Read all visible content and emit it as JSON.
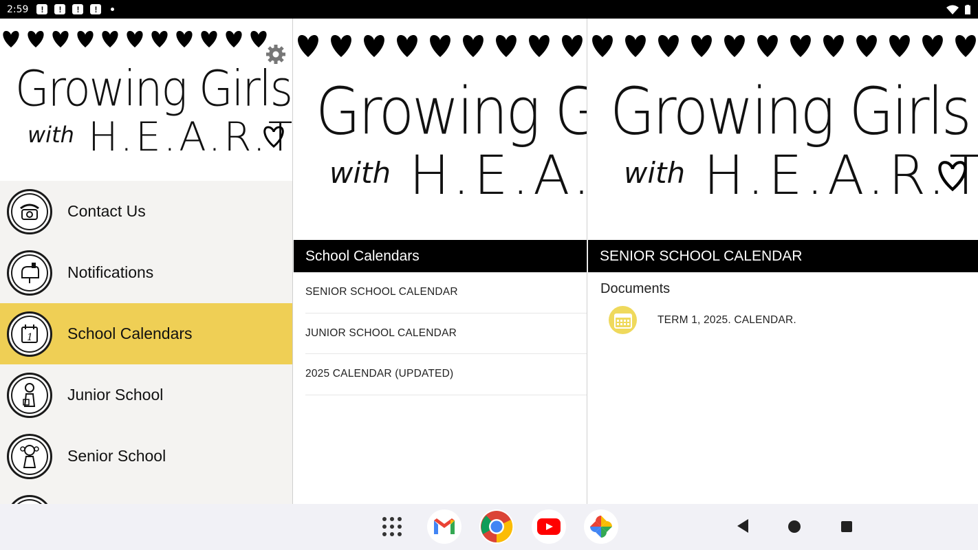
{
  "status_bar": {
    "time": "2:59",
    "notifications": [
      "!",
      "!",
      "!",
      "!"
    ],
    "icons": [
      "wifi-icon",
      "battery-icon"
    ]
  },
  "banner": {
    "title": "Growing Girls",
    "subtitle_with": "with",
    "subtitle_heart": "H.E.A.R.T",
    "accent_color": "#f0e94a"
  },
  "drawer": {
    "settings_icon": "gear-icon",
    "items": [
      {
        "label": "Contact Us",
        "icon": "telephone-icon",
        "active": false
      },
      {
        "label": "Notifications",
        "icon": "mailbox-icon",
        "active": false
      },
      {
        "label": "School Calendars",
        "icon": "calendar-icon",
        "active": true
      },
      {
        "label": "Junior School",
        "icon": "girl-junior-icon",
        "active": false
      },
      {
        "label": "Senior School",
        "icon": "girl-senior-icon",
        "active": false
      }
    ],
    "active_color": "#efcf55"
  },
  "middle": {
    "header": "School Calendars",
    "items": [
      "SENIOR SCHOOL CALENDAR",
      "JUNIOR SCHOOL CALENDAR",
      "2025 CALENDAR (UPDATED)"
    ]
  },
  "detail": {
    "header": "SENIOR SCHOOL CALENDAR",
    "section": "Documents",
    "documents": [
      {
        "label": "TERM 1, 2025. CALENDAR.",
        "icon": "calendar-icon"
      }
    ]
  },
  "nav": {
    "apps": [
      "app-drawer-icon",
      "gmail-icon",
      "chrome-icon",
      "youtube-icon",
      "photos-icon"
    ],
    "buttons": [
      "back-icon",
      "home-icon",
      "recents-icon"
    ]
  }
}
